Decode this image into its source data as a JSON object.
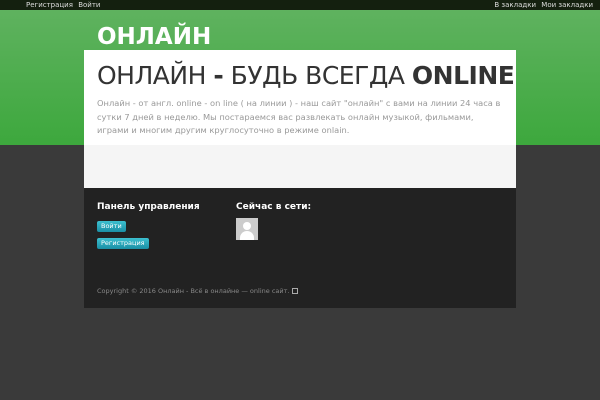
{
  "topbar": {
    "left": [
      "Регистрация",
      "Войти"
    ],
    "right": [
      "В закладки",
      "Мои закладки"
    ]
  },
  "header": {
    "logo": "ОНЛАЙН"
  },
  "hero": {
    "title_part1": "ОНЛАЙН ",
    "title_dash": "-",
    "title_part2": " БУДЬ ВСЕГДА ",
    "title_bold": "ONLINE",
    "text": "Онлайн - от англ. online - on line ( на линии ) - наш сайт \"онлайн\" с вами на линии 24 часа в сутки 7 дней в неделю. Мы постараемся вас развлекать онлайн музыкой, фильмами, играми и многим другим круглосуточно в режиме onlain."
  },
  "footer": {
    "panel_title": "Панель управления",
    "login_button": "Войти",
    "register_button": "Регистрация",
    "online_title": "Сейчас в сети:",
    "copyright": "Copyright © 2016 Онлайн - Всё в онлайне — online сайт."
  }
}
